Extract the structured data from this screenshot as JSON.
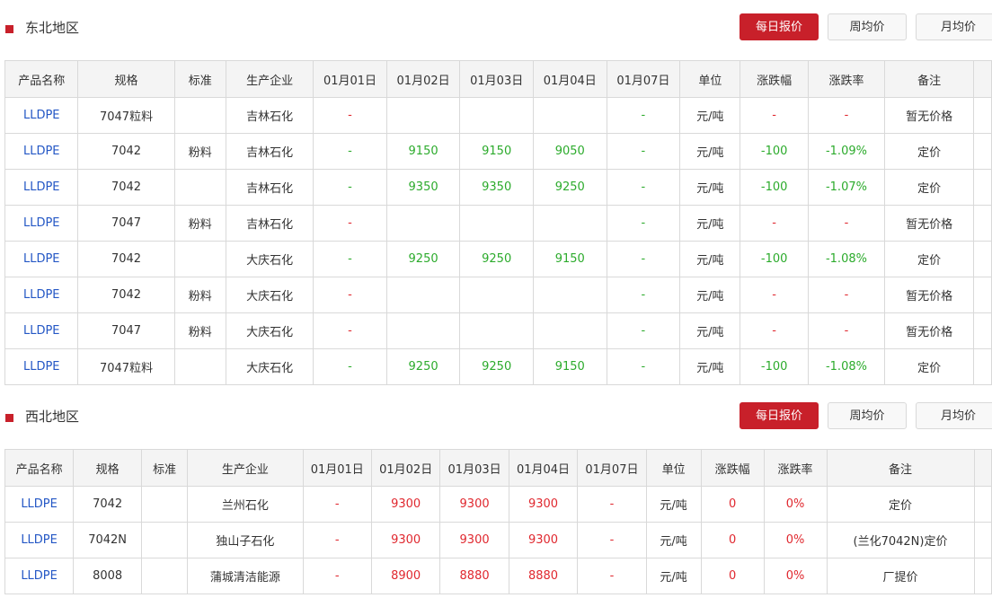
{
  "headers_ne": [
    "产品名称",
    "规格",
    "标准",
    "生产企业",
    "01月01日",
    "01月02日",
    "01月03日",
    "01月04日",
    "01月07日",
    "单位",
    "涨跌幅",
    "涨跌率",
    "备注"
  ],
  "headers_nw": [
    "产品名称",
    "规格",
    "标准",
    "生产企业",
    "01月01日",
    "01月02日",
    "01月03日",
    "01月04日",
    "01月07日",
    "单位",
    "涨跌幅",
    "涨跌率",
    "备注"
  ],
  "buttons": {
    "daily": "每日报价",
    "weekly": "周均价",
    "monthly": "月均价"
  },
  "colors": {
    "accent": "#c8202a",
    "link": "#2457c5",
    "up": "#e0282f",
    "down": "#2cab2c"
  },
  "regions": [
    {
      "title": "东北地区",
      "rows": [
        [
          "LLDPE",
          "7047粒料",
          "",
          "吉林石化",
          "-",
          "",
          "",
          "",
          "-",
          "元/吨",
          "-",
          "-",
          "暂无价格"
        ],
        [
          "LLDPE",
          "7042",
          "粉料",
          "吉林石化",
          "-",
          "9150",
          "9150",
          "9050",
          "-",
          "元/吨",
          "-100",
          "-1.09%",
          "定价"
        ],
        [
          "LLDPE",
          "7042",
          "",
          "吉林石化",
          "-",
          "9350",
          "9350",
          "9250",
          "-",
          "元/吨",
          "-100",
          "-1.07%",
          "定价"
        ],
        [
          "LLDPE",
          "7047",
          "粉料",
          "吉林石化",
          "-",
          "",
          "",
          "",
          "-",
          "元/吨",
          "-",
          "-",
          "暂无价格"
        ],
        [
          "LLDPE",
          "7042",
          "",
          "大庆石化",
          "-",
          "9250",
          "9250",
          "9150",
          "-",
          "元/吨",
          "-100",
          "-1.08%",
          "定价"
        ],
        [
          "LLDPE",
          "7042",
          "粉料",
          "大庆石化",
          "-",
          "",
          "",
          "",
          "-",
          "元/吨",
          "-",
          "-",
          "暂无价格"
        ],
        [
          "LLDPE",
          "7047",
          "粉料",
          "大庆石化",
          "-",
          "",
          "",
          "",
          "-",
          "元/吨",
          "-",
          "-",
          "暂无价格"
        ],
        [
          "LLDPE",
          "7047粒料",
          "",
          "大庆石化",
          "-",
          "9250",
          "9250",
          "9150",
          "-",
          "元/吨",
          "-100",
          "-1.08%",
          "定价"
        ]
      ]
    },
    {
      "title": "西北地区",
      "rows": [
        [
          "LLDPE",
          "7042",
          "",
          "兰州石化",
          "-",
          "9300",
          "9300",
          "9300",
          "-",
          "元/吨",
          "0",
          "0%",
          "定价"
        ],
        [
          "LLDPE",
          "7042N",
          "",
          "独山子石化",
          "-",
          "9300",
          "9300",
          "9300",
          "-",
          "元/吨",
          "0",
          "0%",
          "(兰化7042N)定价"
        ],
        [
          "LLDPE",
          "8008",
          "",
          "蒲城清洁能源",
          "-",
          "8900",
          "8880",
          "8880",
          "-",
          "元/吨",
          "0",
          "0%",
          "厂提价"
        ]
      ]
    }
  ]
}
